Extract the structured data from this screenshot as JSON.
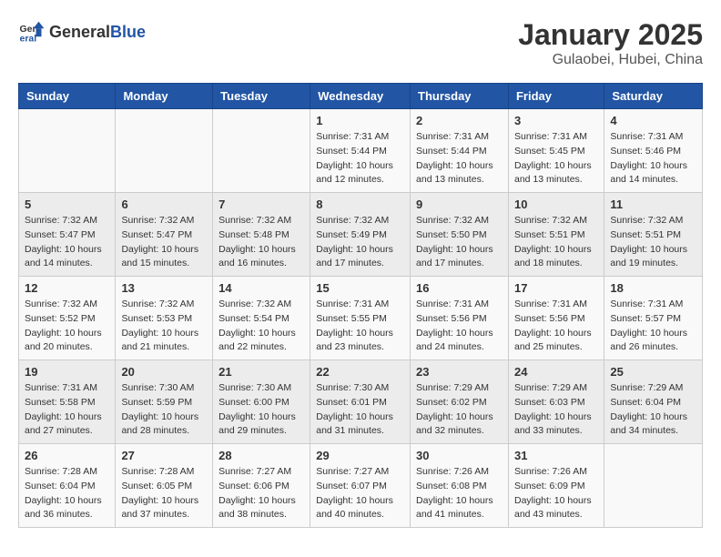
{
  "header": {
    "logo_general": "General",
    "logo_blue": "Blue",
    "month_title": "January 2025",
    "location": "Gulaobei, Hubei, China"
  },
  "days_of_week": [
    "Sunday",
    "Monday",
    "Tuesday",
    "Wednesday",
    "Thursday",
    "Friday",
    "Saturday"
  ],
  "weeks": [
    [
      {
        "day": "",
        "info": ""
      },
      {
        "day": "",
        "info": ""
      },
      {
        "day": "",
        "info": ""
      },
      {
        "day": "1",
        "info": "Sunrise: 7:31 AM\nSunset: 5:44 PM\nDaylight: 10 hours\nand 12 minutes."
      },
      {
        "day": "2",
        "info": "Sunrise: 7:31 AM\nSunset: 5:44 PM\nDaylight: 10 hours\nand 13 minutes."
      },
      {
        "day": "3",
        "info": "Sunrise: 7:31 AM\nSunset: 5:45 PM\nDaylight: 10 hours\nand 13 minutes."
      },
      {
        "day": "4",
        "info": "Sunrise: 7:31 AM\nSunset: 5:46 PM\nDaylight: 10 hours\nand 14 minutes."
      }
    ],
    [
      {
        "day": "5",
        "info": "Sunrise: 7:32 AM\nSunset: 5:47 PM\nDaylight: 10 hours\nand 14 minutes."
      },
      {
        "day": "6",
        "info": "Sunrise: 7:32 AM\nSunset: 5:47 PM\nDaylight: 10 hours\nand 15 minutes."
      },
      {
        "day": "7",
        "info": "Sunrise: 7:32 AM\nSunset: 5:48 PM\nDaylight: 10 hours\nand 16 minutes."
      },
      {
        "day": "8",
        "info": "Sunrise: 7:32 AM\nSunset: 5:49 PM\nDaylight: 10 hours\nand 17 minutes."
      },
      {
        "day": "9",
        "info": "Sunrise: 7:32 AM\nSunset: 5:50 PM\nDaylight: 10 hours\nand 17 minutes."
      },
      {
        "day": "10",
        "info": "Sunrise: 7:32 AM\nSunset: 5:51 PM\nDaylight: 10 hours\nand 18 minutes."
      },
      {
        "day": "11",
        "info": "Sunrise: 7:32 AM\nSunset: 5:51 PM\nDaylight: 10 hours\nand 19 minutes."
      }
    ],
    [
      {
        "day": "12",
        "info": "Sunrise: 7:32 AM\nSunset: 5:52 PM\nDaylight: 10 hours\nand 20 minutes."
      },
      {
        "day": "13",
        "info": "Sunrise: 7:32 AM\nSunset: 5:53 PM\nDaylight: 10 hours\nand 21 minutes."
      },
      {
        "day": "14",
        "info": "Sunrise: 7:32 AM\nSunset: 5:54 PM\nDaylight: 10 hours\nand 22 minutes."
      },
      {
        "day": "15",
        "info": "Sunrise: 7:31 AM\nSunset: 5:55 PM\nDaylight: 10 hours\nand 23 minutes."
      },
      {
        "day": "16",
        "info": "Sunrise: 7:31 AM\nSunset: 5:56 PM\nDaylight: 10 hours\nand 24 minutes."
      },
      {
        "day": "17",
        "info": "Sunrise: 7:31 AM\nSunset: 5:56 PM\nDaylight: 10 hours\nand 25 minutes."
      },
      {
        "day": "18",
        "info": "Sunrise: 7:31 AM\nSunset: 5:57 PM\nDaylight: 10 hours\nand 26 minutes."
      }
    ],
    [
      {
        "day": "19",
        "info": "Sunrise: 7:31 AM\nSunset: 5:58 PM\nDaylight: 10 hours\nand 27 minutes."
      },
      {
        "day": "20",
        "info": "Sunrise: 7:30 AM\nSunset: 5:59 PM\nDaylight: 10 hours\nand 28 minutes."
      },
      {
        "day": "21",
        "info": "Sunrise: 7:30 AM\nSunset: 6:00 PM\nDaylight: 10 hours\nand 29 minutes."
      },
      {
        "day": "22",
        "info": "Sunrise: 7:30 AM\nSunset: 6:01 PM\nDaylight: 10 hours\nand 31 minutes."
      },
      {
        "day": "23",
        "info": "Sunrise: 7:29 AM\nSunset: 6:02 PM\nDaylight: 10 hours\nand 32 minutes."
      },
      {
        "day": "24",
        "info": "Sunrise: 7:29 AM\nSunset: 6:03 PM\nDaylight: 10 hours\nand 33 minutes."
      },
      {
        "day": "25",
        "info": "Sunrise: 7:29 AM\nSunset: 6:04 PM\nDaylight: 10 hours\nand 34 minutes."
      }
    ],
    [
      {
        "day": "26",
        "info": "Sunrise: 7:28 AM\nSunset: 6:04 PM\nDaylight: 10 hours\nand 36 minutes."
      },
      {
        "day": "27",
        "info": "Sunrise: 7:28 AM\nSunset: 6:05 PM\nDaylight: 10 hours\nand 37 minutes."
      },
      {
        "day": "28",
        "info": "Sunrise: 7:27 AM\nSunset: 6:06 PM\nDaylight: 10 hours\nand 38 minutes."
      },
      {
        "day": "29",
        "info": "Sunrise: 7:27 AM\nSunset: 6:07 PM\nDaylight: 10 hours\nand 40 minutes."
      },
      {
        "day": "30",
        "info": "Sunrise: 7:26 AM\nSunset: 6:08 PM\nDaylight: 10 hours\nand 41 minutes."
      },
      {
        "day": "31",
        "info": "Sunrise: 7:26 AM\nSunset: 6:09 PM\nDaylight: 10 hours\nand 43 minutes."
      },
      {
        "day": "",
        "info": ""
      }
    ]
  ]
}
